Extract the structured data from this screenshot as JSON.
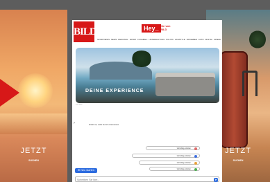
{
  "left_ad": {
    "cta_big": "JETZT",
    "cta_small": "SUCHEN"
  },
  "right_ad": {
    "cta_big": "JETZT",
    "cta_small": "SUCHEN"
  },
  "header": {
    "logo": "BILD",
    "hey_label": "Hey_",
    "von_bild": "Die von BILD",
    "nav": [
      "SPORTNEWS",
      "NEWS",
      "REGIONAL",
      "SPORT",
      "FUSSBALL",
      "UNTERHALTUNG",
      "POLITIK",
      "LIFESTYLE",
      "RATGEBER",
      "AUTO",
      "DIGITAL",
      "SPIELE"
    ]
  },
  "hero": {
    "title": "DEINE EXPERIENCE",
    "caption": "Foto: BILD"
  },
  "chat": {
    "message": "Erzähl mir, wofür du dich interessierst",
    "suggestions": [
      {
        "label": "Vorschlag einholen",
        "color": "#e06b6b"
      },
      {
        "label": "Vorschlag einholen",
        "color": "#3e6fe0"
      },
      {
        "label": "Vorschlag einholen",
        "color": "#e8a23a"
      },
      {
        "label": "Vorschlag einholen",
        "color": "#4caf50"
      }
    ],
    "new_chat": "Neu starten",
    "input_placeholder": "Schreiben Sie hier..."
  }
}
